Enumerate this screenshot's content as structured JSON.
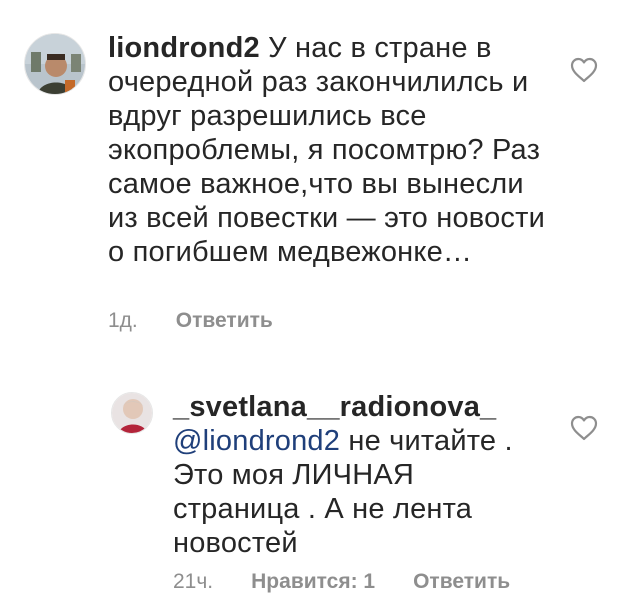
{
  "comments": [
    {
      "username": "liondrond2",
      "text": "У нас в стране в очередной раз закончилилсь и вдруг разрешились все экопроблемы, я посомтрю? Раз самое важное,что вы вынесли из всей повестки — это новости о погибшем медвежонке…",
      "time": "1д.",
      "reply_label": "Ответить",
      "like_icon": "heart-outline-icon"
    },
    {
      "username": "_svetlana__radionova_",
      "mention": "@liondrond2",
      "text": "не читайте . Это моя ЛИЧНАЯ страница . А не лента новостей",
      "time": "21ч.",
      "likes_label": "Нравится: 1",
      "reply_label": "Ответить",
      "like_icon": "heart-outline-icon"
    }
  ]
}
